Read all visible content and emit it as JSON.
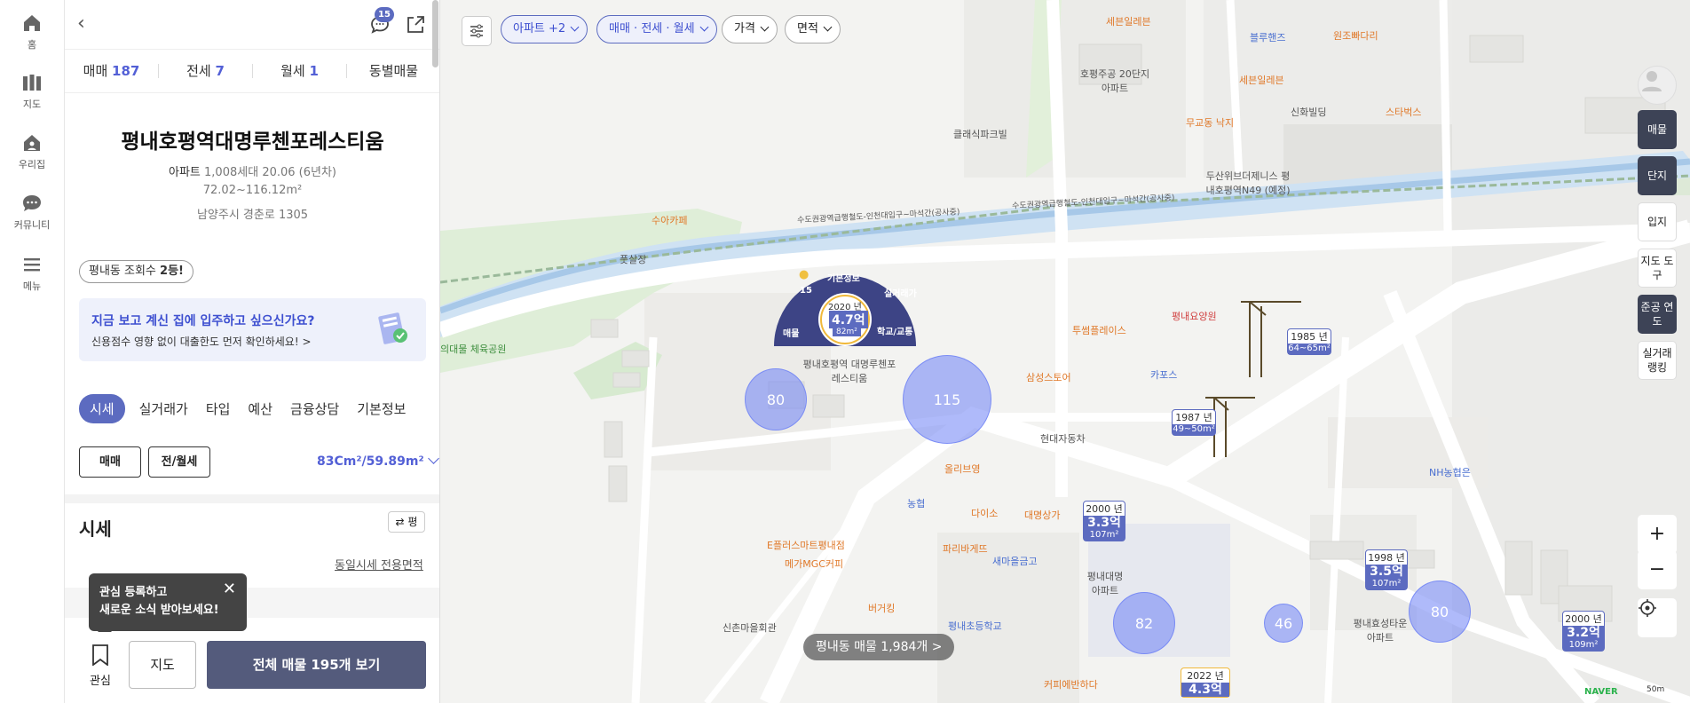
{
  "nav": {
    "items": [
      {
        "label": "홈",
        "icon": "home-icon"
      },
      {
        "label": "지도",
        "icon": "map-icon"
      },
      {
        "label": "우리집",
        "icon": "house-user-icon"
      },
      {
        "label": "커뮤니티",
        "icon": "chat-bubble-icon"
      },
      {
        "label": "메뉴",
        "icon": "hamburger-icon"
      }
    ]
  },
  "panel": {
    "notification_count": "15",
    "deal_tabs": [
      {
        "label": "매매",
        "count": "187"
      },
      {
        "label": "전세",
        "count": "7"
      },
      {
        "label": "월세",
        "count": "1"
      },
      {
        "label": "동별매물",
        "count": ""
      }
    ],
    "complex_name": "평내호평역대명루첸포레스티움",
    "type": "아파트",
    "households": "1,008세대",
    "built": "20.06 (6년차)",
    "area_range": "72.02~116.12m²",
    "address": "남양주시 경춘로 1305",
    "views_prefix": "평내동 조회수 ",
    "views_rank": "2등!",
    "promo": {
      "title": "지금 보고 계신 집에 입주하고 싶으신가요?",
      "text": "신용점수 영향 없이 대출한도 먼저 확인하세요! >"
    },
    "section_tabs": [
      "시세",
      "실거래가",
      "타입",
      "예산",
      "금융상담",
      "기본정보"
    ],
    "deal_select": [
      "매매",
      "전/월세"
    ],
    "area_select": "83Cm²/59.89m²",
    "price_heading": "시세",
    "pyeong_btn": "평",
    "same_price_link": "동일시세 전용면적",
    "tooltip": {
      "line1": "관심 등록하고",
      "line2": "새로운 소식 받아보세요!"
    },
    "bottom": {
      "fav": "관심",
      "map": "지도",
      "all": "전체 매물 195개 보기"
    }
  },
  "map": {
    "filters": [
      "아파트 +2",
      "매매 · 전세 · 월세",
      "가격",
      "면적"
    ],
    "right_buttons": [
      "매물",
      "단지",
      "입지",
      "지도 도구",
      "준공 연도",
      "실거래 랭킹"
    ],
    "radial": {
      "info": "기본정보",
      "deals": "실거래가",
      "school": "학교/교통",
      "listing": "매물",
      "count": "15",
      "year": "2020 년",
      "price": "4.7억",
      "area": "82m²"
    },
    "complex_label": "평내호평역 대명루첸포레스티움",
    "pins": [
      {
        "year": "1985 년",
        "area": "64~65m²"
      },
      {
        "year": "1987 년",
        "area": "49~50m²"
      },
      {
        "year": "2000 년",
        "price": "3.3억",
        "area": "107m²"
      },
      {
        "year": "1998 년",
        "price": "3.5억",
        "area": "107m²"
      },
      {
        "year": "2000 년",
        "price": "3.2억",
        "area": "109m²"
      },
      {
        "year": "2022 년",
        "price": "4.3억",
        "area": ""
      }
    ],
    "clusters": [
      "80",
      "115",
      "82",
      "46",
      "80"
    ],
    "labels": {
      "seven": "세븐일레븐",
      "blue": "블루핸즈",
      "won": "원조빠다리",
      "hop": "호평주공 20단지아파트",
      "seven2": "세븐일레븐",
      "mu": "무교동 낙지",
      "star": "스타벅스",
      "shin": "신화빌딩",
      "club": "클래식파크빌",
      "doosan": "두산위브더제니스 평내호평역N49 (예정)",
      "suwon": "수아카페",
      "pot": "풋살장",
      "metro1": "수도권광역급행철도-인천대입구~마석간(공사중)",
      "metro2": "수도권광역급행철도-인천대입구~마석간(공사중)",
      "twosome": "투썸플레이스",
      "samsung": "삼성스토어",
      "pyonghos": "평내요양원",
      "kapo": "카포스",
      "hyundai": "현대자동차",
      "olive": "올리브영",
      "nonghyup": "농협",
      "daiso": "다이소",
      "daemyung": "대명상가",
      "eplus": "E플러스마트평내점",
      "paris": "파리바게뜨",
      "mega": "메가MGC커피",
      "burger": "버거킹",
      "saemaul": "새마을금고",
      "elem": "평내초등학교",
      "shinchon": "신촌마을회관",
      "coffee": "커피에반하다",
      "daemyung_apt": "평내대명 아파트",
      "hyosung": "평내효성타운 아파트",
      "nh": "NH농협은",
      "sports": "의대물 체육공원"
    },
    "count_label": "평내동 매물 1,984개 >",
    "naver": "NAVER",
    "scale": "50m"
  }
}
